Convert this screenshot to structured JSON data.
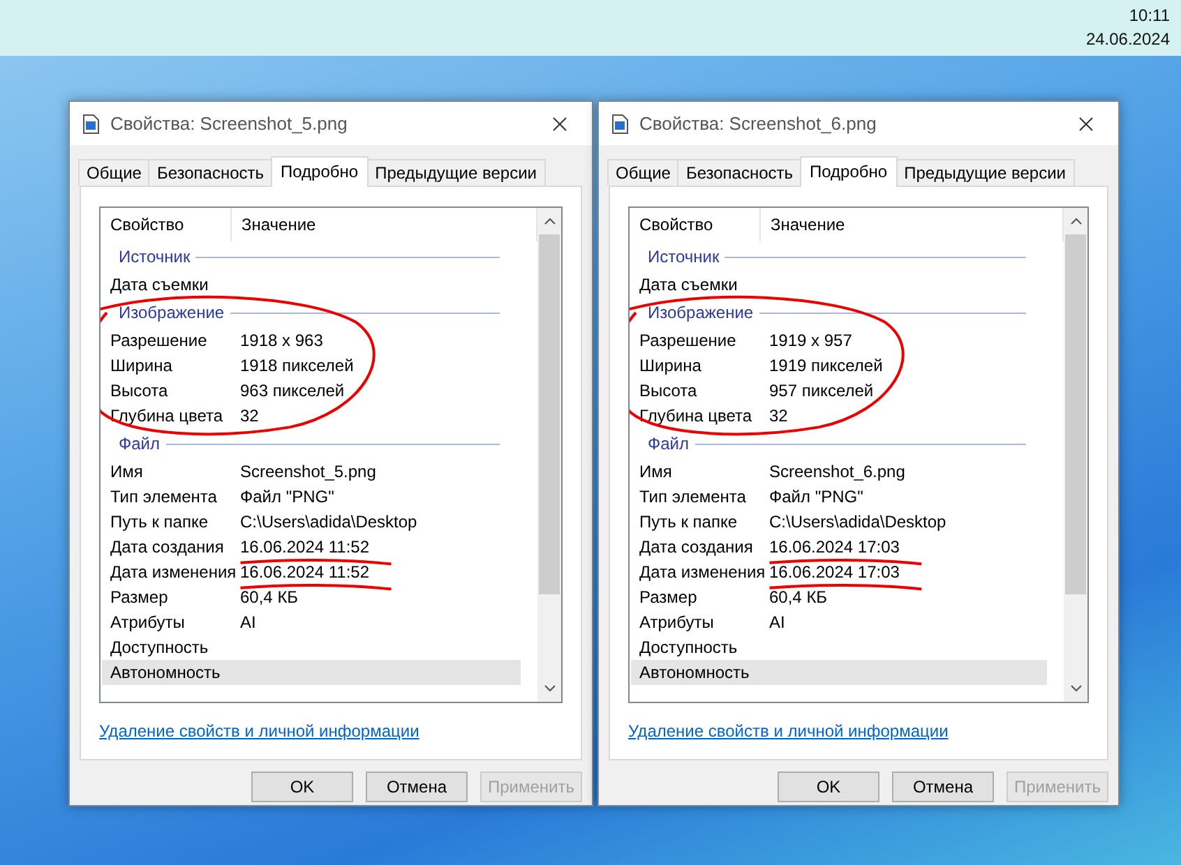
{
  "clock": {
    "time": "10:11",
    "date": "24.06.2024"
  },
  "dialogs": [
    {
      "title": "Свойства: Screenshot_5.png",
      "tabs": [
        {
          "label": "Общие",
          "selected": false
        },
        {
          "label": "Безопасность",
          "selected": false
        },
        {
          "label": "Подробно",
          "selected": true
        },
        {
          "label": "Предыдущие версии",
          "selected": false
        }
      ],
      "columns": [
        "Свойство",
        "Значение"
      ],
      "sections": [
        {
          "heading": "Источник",
          "rows": [
            {
              "property": "Дата съемки",
              "selected": false
            }
          ]
        },
        {
          "heading": "Изображение",
          "circled": true,
          "rows": [
            {
              "property": "Разрешение",
              "value": "1918 x 963",
              "selected": false
            },
            {
              "property": "Ширина",
              "value": "1918 пикселей",
              "selected": false
            },
            {
              "property": "Высота",
              "value": "963 пикселей",
              "selected": false
            },
            {
              "property": "Глубина цвета",
              "value": "32",
              "selected": false
            }
          ]
        },
        {
          "heading": "Файл",
          "rows": [
            {
              "property": "Имя",
              "value": "Screenshot_5.png",
              "selected": false
            },
            {
              "property": "Тип элемента",
              "value": "Файл \"PNG\"",
              "selected": false
            },
            {
              "property": "Путь к папке",
              "value": "C:\\Users\\adida\\Desktop",
              "selected": false
            },
            {
              "property": "Дата создания",
              "value": "16.06.2024 11:52",
              "selected": false,
              "underlined": true
            },
            {
              "property": "Дата изменения",
              "value": "16.06.2024 11:52",
              "selected": false,
              "underlined": true
            },
            {
              "property": "Размер",
              "value": "60,4 КБ",
              "selected": false
            },
            {
              "property": "Атрибуты",
              "value": "AI",
              "selected": false
            },
            {
              "property": "Доступность",
              "selected": false
            },
            {
              "property": "Автономность",
              "selected": true
            }
          ]
        }
      ],
      "link": "Удаление свойств и личной информации",
      "buttons": [
        {
          "label": "OK",
          "disabled": false
        },
        {
          "label": "Отмена",
          "disabled": false
        },
        {
          "label": "Применить",
          "disabled": true
        }
      ]
    },
    {
      "title": "Свойства: Screenshot_6.png",
      "tabs": [
        {
          "label": "Общие",
          "selected": false
        },
        {
          "label": "Безопасность",
          "selected": false
        },
        {
          "label": "Подробно",
          "selected": true
        },
        {
          "label": "Предыдущие версии",
          "selected": false
        }
      ],
      "columns": [
        "Свойство",
        "Значение"
      ],
      "sections": [
        {
          "heading": "Источник",
          "rows": [
            {
              "property": "Дата съемки",
              "selected": false
            }
          ]
        },
        {
          "heading": "Изображение",
          "circled": true,
          "rows": [
            {
              "property": "Разрешение",
              "value": "1919 x 957",
              "selected": false
            },
            {
              "property": "Ширина",
              "value": "1919 пикселей",
              "selected": false
            },
            {
              "property": "Высота",
              "value": "957 пикселей",
              "selected": false
            },
            {
              "property": "Глубина цвета",
              "value": "32",
              "selected": false
            }
          ]
        },
        {
          "heading": "Файл",
          "rows": [
            {
              "property": "Имя",
              "value": "Screenshot_6.png",
              "selected": false
            },
            {
              "property": "Тип элемента",
              "value": "Файл \"PNG\"",
              "selected": false
            },
            {
              "property": "Путь к папке",
              "value": "C:\\Users\\adida\\Desktop",
              "selected": false
            },
            {
              "property": "Дата создания",
              "value": "16.06.2024 17:03",
              "selected": false,
              "underlined": true
            },
            {
              "property": "Дата изменения",
              "value": "16.06.2024 17:03",
              "selected": false,
              "underlined": true
            },
            {
              "property": "Размер",
              "value": "60,4 КБ",
              "selected": false
            },
            {
              "property": "Атрибуты",
              "value": "AI",
              "selected": false
            },
            {
              "property": "Доступность",
              "selected": false
            },
            {
              "property": "Автономность",
              "selected": true
            }
          ]
        }
      ],
      "link": "Удаление свойств и личной информации",
      "buttons": [
        {
          "label": "OK",
          "disabled": false
        },
        {
          "label": "Отмена",
          "disabled": false
        },
        {
          "label": "Применить",
          "disabled": true
        }
      ]
    }
  ]
}
